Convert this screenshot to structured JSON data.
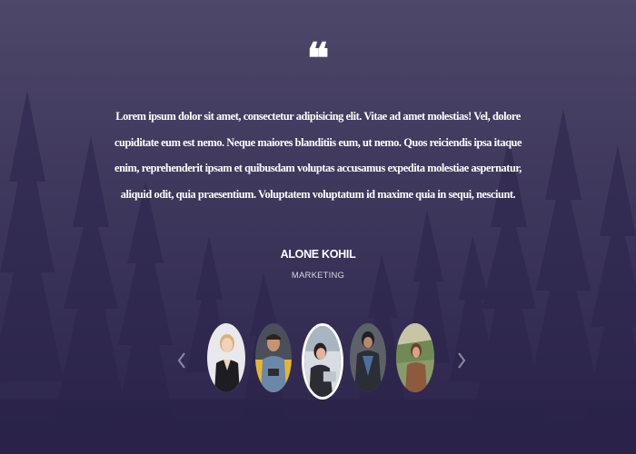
{
  "testimonial": {
    "quote_icon": "quote-icon",
    "text": "Lorem ipsum dolor sit amet, consectetur adipisicing elit. Vitae ad amet molestias! Vel, dolore cupiditate eum est nemo. Neque maiores blanditiis eum, ut nemo. Quos reiciendis ipsa itaque enim, reprehenderit ipsam et quibusdam voluptas accusamus expedita molestiae aspernatur, aliquid odit, quia praesentium. Voluptatem voluptatum id maxime quia in sequi, nesciunt.",
    "name": "ALONE KOHIL",
    "role": "MARKETING"
  },
  "carousel": {
    "prev_icon": "chevron-left-icon",
    "next_icon": "chevron-right-icon",
    "active_index": 2,
    "avatars": [
      {
        "name": "avatar-woman-blonde"
      },
      {
        "name": "avatar-man-yellow-chair"
      },
      {
        "name": "avatar-woman-laptop"
      },
      {
        "name": "avatar-man-standing"
      },
      {
        "name": "avatar-woman-outdoors"
      }
    ]
  },
  "colors": {
    "background": "#3a3358",
    "text": "#ffffff",
    "role_text": "#d8d4e4",
    "active_border": "#ffffff"
  }
}
